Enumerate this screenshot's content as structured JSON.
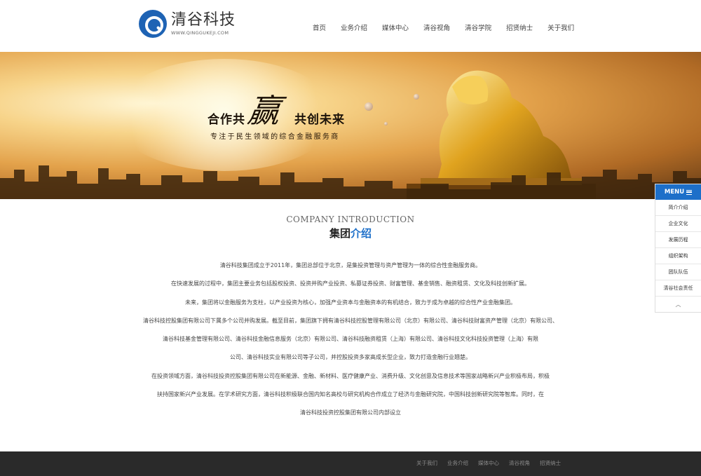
{
  "logo": {
    "name_cn": "清谷科技",
    "domain": "WWW.QINGGUKEJI.COM",
    "brand_color": "#1e63b4"
  },
  "nav": [
    "首页",
    "业务介绍",
    "媒体中心",
    "清谷视角",
    "清谷学院",
    "招贤纳士",
    "关于我们"
  ],
  "banner": {
    "slogan_a": "合作共",
    "slogan_calligraphy": "赢",
    "slogan_b": "共创未来",
    "subslogan": "专注于民生领域的综合金融服务商"
  },
  "sidemenu": {
    "title": "MENU",
    "items": [
      "简介介绍",
      "企业文化",
      "发展历程",
      "组织架构",
      "团队队伍",
      "清谷社会责任"
    ],
    "accent": "#1d6fc9"
  },
  "section": {
    "title_en": "COMPANY INTRODUCTION",
    "title_cn_a": "集团",
    "title_cn_b": "介绍"
  },
  "intro_lines": [
    "清谷科技集团成立于2011年，集团总部位于北京，是集投资管理与资产管理为一体的综合性金融服务商。",
    "在快速发展的过程中，集团主要业务包括股权投资、投资并购产业投资、私募证券投资、财富管理、基金销售、融资租赁、文化及科技创新扩展。",
    "未来，集团将以金融服务为支柱，以产业投资为核心，加强产业资本与金融资本的有机结合，致力于成为卓越的综合性产业金融集团。",
    "清谷科技控股集团有限公司下属多个公司并购发展。截至目前，集团旗下拥有清谷科技控股管理有限公司（北京）有限公司、清谷科技财富资产管理（北京）有限公司、",
    "清谷科技基金管理有限公司、清谷科技金融信息服务（北京）有限公司、清谷科技融资租赁（上海）有限公司、清谷科技文化科技投资管理（上海）有限",
    "公司、清谷科技实业有限公司等子公司，并控股投资多家高成长型企业，致力打造金融行业翘楚。",
    "在投资领域方面，清谷科技投资控股集团有限公司在新能源、金融、新材料、医疗健康产业、消费升级、文化创意及信息技术等国家战略新兴产业积极布局，积极",
    "扶持国家新兴产业发展。在学术研究方面，清谷科技积极联合国内知名高校与研究机构合作成立了经济与金融研究院，中国科技创新研究院等智库。同时，在",
    "清谷科技投资控股集团有限公司内部设立"
  ],
  "footer": {
    "links": [
      "关于我们",
      "业务介绍",
      "媒体中心",
      "清谷视角",
      "招贤纳士"
    ]
  }
}
